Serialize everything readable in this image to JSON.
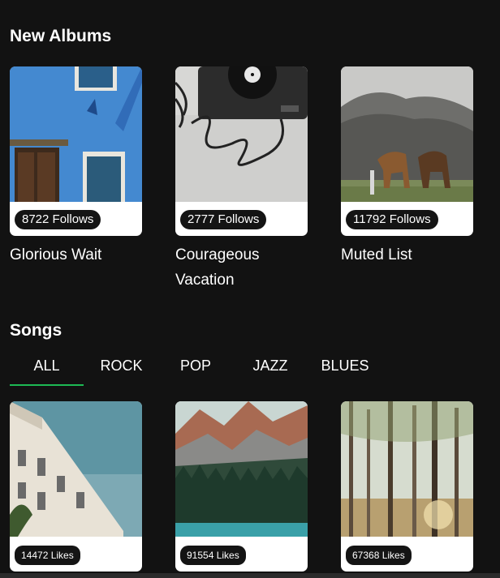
{
  "new_albums": {
    "title": "New Albums",
    "items": [
      {
        "title": "Glorious Wait",
        "follows": "8722 Follows"
      },
      {
        "title": "Courageous Vacation",
        "follows": "2777 Follows"
      },
      {
        "title": "Muted List",
        "follows": "11792 Follows"
      }
    ]
  },
  "songs": {
    "title": "Songs",
    "tabs": [
      "ALL",
      "ROCK",
      "POP",
      "JAZZ",
      "BLUES"
    ],
    "active_tab": "ALL",
    "items": [
      {
        "likes": "14472 Likes"
      },
      {
        "likes": "91554 Likes"
      },
      {
        "likes": "67368 Likes"
      }
    ]
  },
  "colors": {
    "background": "#121212",
    "accent": "#1db954",
    "badge": "#141414"
  }
}
